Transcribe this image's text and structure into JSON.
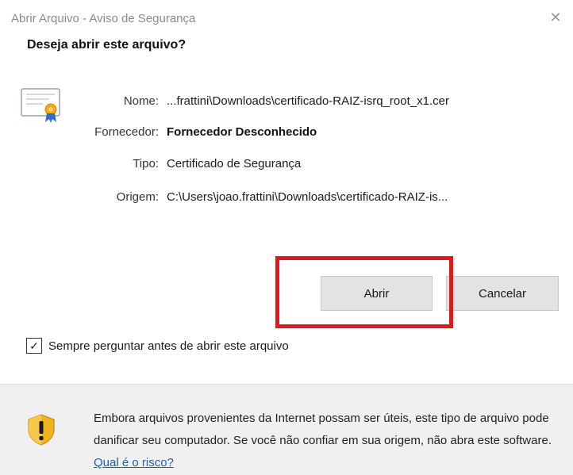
{
  "window": {
    "title": "Abrir Arquivo - Aviso de Segurança",
    "close_glyph": "✕"
  },
  "dialog": {
    "question": "Deseja abrir este arquivo?",
    "icon": "certificate-icon",
    "fields": {
      "name_label": "Nome:",
      "name_value": "...frattini\\Downloads\\certificado-RAIZ-isrq_root_x1.cer",
      "vendor_label": "Fornecedor:",
      "vendor_value": "Fornecedor Desconhecido",
      "type_label": "Tipo:",
      "type_value": "Certificado de Segurança",
      "origin_label": "Origem:",
      "origin_value": "C:\\Users\\joao.frattini\\Downloads\\certificado-RAIZ-is..."
    },
    "buttons": {
      "open": "Abrir",
      "cancel": "Cancelar"
    },
    "always_ask": {
      "label": "Sempre perguntar antes de abrir este arquivo",
      "checked": true,
      "check_glyph": "✓"
    },
    "warning": {
      "icon": "shield-warning-icon",
      "text": "Embora arquivos provenientes da Internet possam ser úteis, este tipo de arquivo pode danificar seu computador. Se você não confiar em sua origem, não abra este software.",
      "link": "Qual é o risco?"
    }
  },
  "colors": {
    "highlight": "#e01a1a",
    "link": "#1a5fb4",
    "dialog_bg": "#f0f0f0",
    "content_bg": "#ffffff"
  }
}
